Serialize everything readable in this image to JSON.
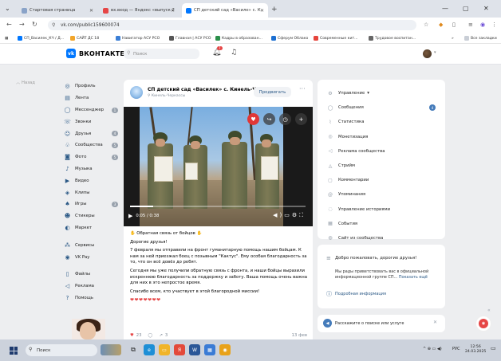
{
  "browser": {
    "tabs": [
      {
        "label": "Стартовая страница",
        "active": false
      },
      {
        "label": "вх.вход — Яндекс «выпуск 2",
        "active": false
      },
      {
        "label": "СП детский сад «Василе» с. К",
        "active": true
      }
    ],
    "url": "vk.com/public159600074",
    "bookmarks": [
      "СП_Василек_КЧ / Д...",
      "САЙТ ДС 18",
      "Навигатор АСУ РСО",
      "Главная | АСУ РСО",
      "Кадры в образован...",
      "Сферум Облако",
      "Современные кит...",
      "Трудовое воспитан..."
    ],
    "all_bookmarks": "Все закладки"
  },
  "vk": {
    "logo_text": "ВКОНТАКТЕ",
    "search_placeholder": "Поиск",
    "notif_count": "7",
    "back_label": "Назад",
    "menu": [
      {
        "label": "Профиль",
        "icon": "profile-icon",
        "glyph": "◎"
      },
      {
        "label": "Лента",
        "icon": "feed-icon",
        "glyph": "▤"
      },
      {
        "label": "Мессенджер",
        "icon": "messenger-icon",
        "glyph": "◯",
        "badge": "1"
      },
      {
        "label": "Звонки",
        "icon": "phone-icon",
        "glyph": "☏"
      },
      {
        "label": "Друзья",
        "icon": "friends-icon",
        "glyph": "☺",
        "badge": "4"
      },
      {
        "label": "Сообщества",
        "icon": "communities-icon",
        "glyph": "♧",
        "badge": "5"
      },
      {
        "label": "Фото",
        "icon": "photo-icon",
        "glyph": "◙",
        "badge": "5"
      },
      {
        "label": "Музыка",
        "icon": "music-icon",
        "glyph": "♪"
      },
      {
        "label": "Видео",
        "icon": "video-icon",
        "glyph": "▶"
      },
      {
        "label": "Клипы",
        "icon": "clips-icon",
        "glyph": "◈"
      },
      {
        "label": "Игры",
        "icon": "games-icon",
        "glyph": "♠",
        "badge": "3"
      },
      {
        "label": "Стикеры",
        "icon": "stickers-icon",
        "glyph": "☻"
      },
      {
        "label": "Маркет",
        "icon": "market-icon",
        "glyph": "◐"
      }
    ],
    "menu2": [
      {
        "label": "Сервисы",
        "icon": "services-icon",
        "glyph": "⁂"
      },
      {
        "label": "VK Pay",
        "icon": "vkpay-icon",
        "glyph": "◉"
      }
    ],
    "menu3": [
      {
        "label": "Файлы",
        "icon": "files-icon",
        "glyph": "▯"
      },
      {
        "label": "Реклама",
        "icon": "ads-icon",
        "glyph": "◁"
      },
      {
        "label": "Помощь",
        "icon": "help-icon",
        "glyph": "?"
      }
    ]
  },
  "post": {
    "community_name": "СП детский сад «Василек» с. Кинель-Чер...",
    "location": "Кинель-Черкассы",
    "promote_label": "Продвигать",
    "video_time": "0:05 / 0:38",
    "video_progress": 0.13,
    "text_heading": "Обратная связь от бойцов",
    "text_greeting": "Дорогие друзья!",
    "text_p1": "7 февраля мы отправили на фронт гуманитарную помощь нашим бойцам. К нам за ней приезжал боец с позывным \"Кактус\". Ему особая благодарность за то, что он всё довёз до ребят.",
    "text_p2": "Сегодня мы уже получили обратную связь с фронта, и наши бойцы выразили искреннюю благодарность за поддержку и заботу. Ваша помощь очень важна для них в это непростое время.",
    "text_p3": "Спасибо всем, кто участвует в этой благородной миссии!",
    "hearts": "❤❤❤❤❤❤❤",
    "likes": "23",
    "shares": "3",
    "views": "13 фев"
  },
  "right": {
    "menu": [
      {
        "label": "Управление",
        "icon": "manage-icon",
        "glyph": "⚙",
        "extra": "▾"
      },
      {
        "label": "Сообщения",
        "icon": "messages-icon",
        "glyph": "◯",
        "dot": "4"
      },
      {
        "label": "Статистика",
        "icon": "stats-icon",
        "glyph": "⌇"
      },
      {
        "label": "Монетизация",
        "icon": "money-icon",
        "glyph": "◎"
      },
      {
        "label": "Реклама сообщества",
        "icon": "ads-community-icon",
        "glyph": "◁"
      },
      {
        "label": "Стрийм",
        "icon": "stream-icon",
        "glyph": "◬"
      },
      {
        "label": "Комментарии",
        "icon": "comments-icon",
        "glyph": "▢"
      },
      {
        "label": "Упоминания",
        "icon": "mentions-icon",
        "glyph": "@"
      },
      {
        "label": "Управление историями",
        "icon": "stories-icon",
        "glyph": "◌"
      },
      {
        "label": "События",
        "icon": "events-icon",
        "glyph": "▦"
      },
      {
        "label": "Сайт из сообщества",
        "icon": "site-icon",
        "glyph": "◍"
      }
    ],
    "welcome_title": "Добро пожаловать, дорогие друзья!",
    "welcome_body": "Мы рады приветствовать вас в официальной информационной группе СП...",
    "welcome_link": "Показать ещё",
    "more_info": "Подробная информация",
    "news_prompt": "Расскажите о поиске или услуге"
  },
  "taskbar": {
    "search": "Поиск",
    "lang": "РУС",
    "time": "12:56",
    "date": "24.03.2025"
  }
}
